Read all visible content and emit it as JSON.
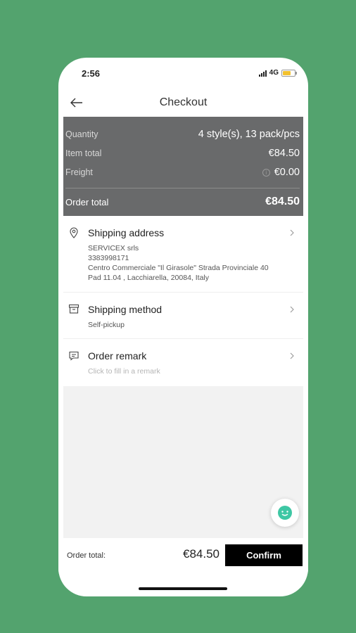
{
  "status": {
    "time": "2:56",
    "network": "4G"
  },
  "nav": {
    "title": "Checkout"
  },
  "summary": {
    "quantity_label": "Quantity",
    "quantity_value": "4 style(s), 13 pack/pcs",
    "item_total_label": "Item total",
    "item_total_value": "€84.50",
    "freight_label": "Freight",
    "freight_value": "€0.00",
    "order_total_label": "Order total",
    "order_total_value": "€84.50"
  },
  "shipping_address": {
    "title": "Shipping address",
    "name": "SERVICEX srls",
    "phone": "3383998171",
    "line1": "Centro Commerciale \"Il Girasole\" Strada Provinciale 40",
    "line2": "Pad 11.04 , Lacchiarella, 20084, Italy"
  },
  "shipping_method": {
    "title": "Shipping method",
    "value": "Self-pickup"
  },
  "order_remark": {
    "title": "Order remark",
    "placeholder": "Click to fill in a remark"
  },
  "footer": {
    "total_label": "Order total:",
    "total_value": "€84.50",
    "confirm_label": "Confirm"
  },
  "colors": {
    "background": "#53a36e",
    "summary_bg": "#696a6b",
    "confirm_bg": "#000000",
    "chat_accent": "#3ec7a4"
  },
  "icons": [
    "back-arrow-icon",
    "location-pin-icon",
    "box-icon",
    "chat-bubble-icon",
    "chevron-right-icon",
    "info-icon",
    "chat-support-icon"
  ]
}
